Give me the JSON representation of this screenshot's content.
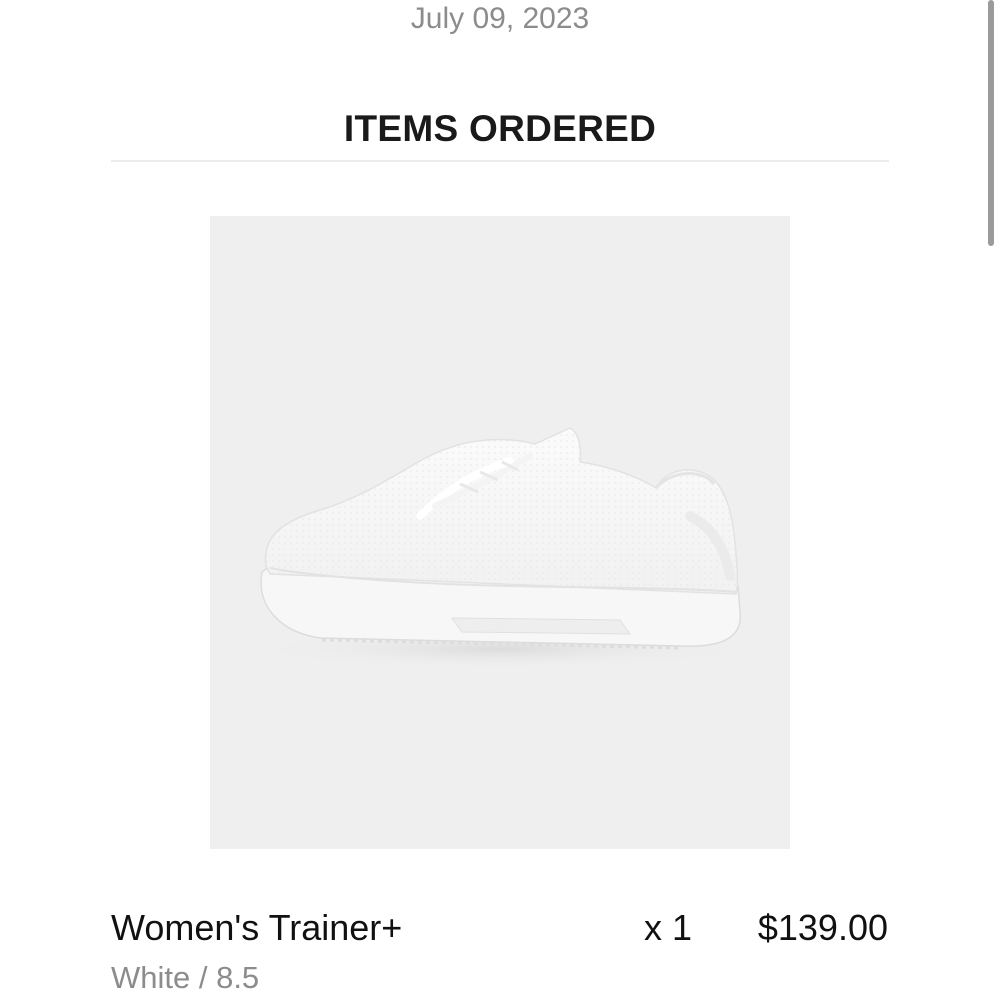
{
  "order": {
    "date": "July 09, 2023"
  },
  "items_section": {
    "title": "ITEMS ORDERED"
  },
  "item": {
    "image_icon": "sneaker-product-photo",
    "name": "Women's Trainer+",
    "quantity": "x 1",
    "price": "$139.00",
    "variant": "White / 8.5"
  },
  "colors": {
    "muted_text": "#8c8c8c",
    "primary_text": "#111111",
    "image_background": "#efefef",
    "divider": "#ececec"
  }
}
